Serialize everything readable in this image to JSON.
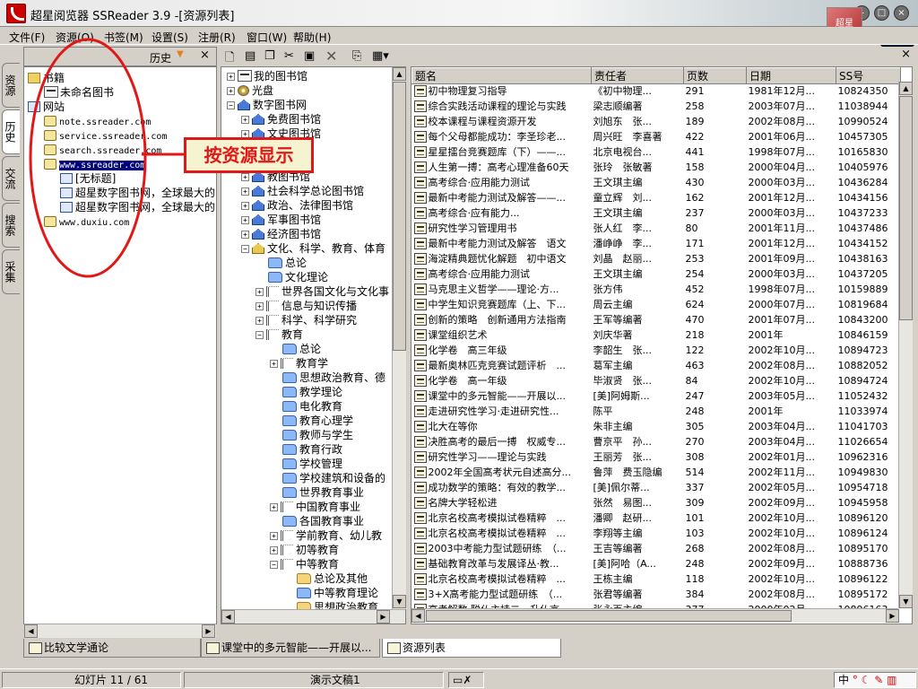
{
  "title": "超星阅览器 SSReader 3.9 -[资源列表]",
  "logos": {
    "brand_label": "超星"
  },
  "menu": [
    "文件(F)",
    "资源(O)",
    "书签(M)",
    "设置(S)",
    "注册(R)",
    "窗口(W)",
    "帮助(H)"
  ],
  "side_tabs": [
    "资源",
    "历史",
    "交流",
    "搜索",
    "采集"
  ],
  "history_panel": {
    "label": "历史",
    "tree": [
      {
        "label": "书籍",
        "type": "folder",
        "level": 0
      },
      {
        "label": "未命名图书",
        "type": "book",
        "level": 1
      },
      {
        "label": "网站",
        "type": "page",
        "level": 0
      },
      {
        "label": "note.ssreader.com",
        "type": "site",
        "level": 1
      },
      {
        "label": "service.ssreader.com",
        "type": "site",
        "level": 1
      },
      {
        "label": "search.ssreader.com",
        "type": "site",
        "level": 1
      },
      {
        "label": "www.ssreader.com",
        "type": "site",
        "level": 1,
        "selected": true
      },
      {
        "label": "[无标题]",
        "type": "page",
        "level": 2
      },
      {
        "label": "超星数字图书网，全球最大的",
        "type": "page",
        "level": 2
      },
      {
        "label": "超星数字图书网，全球最大的",
        "type": "page",
        "level": 2
      },
      {
        "label": "www.duxiu.com",
        "type": "site",
        "level": 1
      }
    ]
  },
  "annotation": {
    "text": "按资源显示"
  },
  "resource_tree": [
    {
      "label": "我的图书馆",
      "toggle": "+",
      "icon": "book",
      "level": 0
    },
    {
      "label": "光盘",
      "toggle": "+",
      "icon": "disc",
      "level": 0
    },
    {
      "label": "数字图书网",
      "toggle": "-",
      "icon": "lib",
      "level": 0
    },
    {
      "label": "免费图书馆",
      "toggle": "+",
      "icon": "lib",
      "level": 1
    },
    {
      "label": "文史图书馆",
      "toggle": "+",
      "icon": "lib",
      "level": 1
    },
    {
      "label": "",
      "toggle": "+",
      "icon": "lib",
      "level": 1
    },
    {
      "label": "图书馆",
      "toggle": "+",
      "icon": "lib",
      "level": 1
    },
    {
      "label": "教图书馆",
      "toggle": "+",
      "icon": "lib",
      "level": 1
    },
    {
      "label": "社会科学总论图书馆",
      "toggle": "+",
      "icon": "lib",
      "level": 1
    },
    {
      "label": "政治、法律图书馆",
      "toggle": "+",
      "icon": "lib",
      "level": 1
    },
    {
      "label": "军事图书馆",
      "toggle": "+",
      "icon": "lib",
      "level": 1
    },
    {
      "label": "经济图书馆",
      "toggle": "+",
      "icon": "lib",
      "level": 1
    },
    {
      "label": "文化、科学、教育、体育",
      "toggle": "-",
      "icon": "lib-y",
      "level": 1
    },
    {
      "label": "总论",
      "toggle": "",
      "icon": "cat",
      "level": 2
    },
    {
      "label": "文化理论",
      "toggle": "",
      "icon": "cat",
      "level": 2
    },
    {
      "label": "世界各国文化与文化事",
      "toggle": "+",
      "icon": "grp",
      "level": 2
    },
    {
      "label": "信息与知识传播",
      "toggle": "+",
      "icon": "grp",
      "level": 2
    },
    {
      "label": "科学、科学研究",
      "toggle": "+",
      "icon": "grp",
      "level": 2
    },
    {
      "label": "教育",
      "toggle": "-",
      "icon": "grp",
      "level": 2
    },
    {
      "label": "总论",
      "toggle": "",
      "icon": "cat",
      "level": 3
    },
    {
      "label": "教育学",
      "toggle": "+",
      "icon": "grp",
      "level": 3
    },
    {
      "label": "思想政治教育、德",
      "toggle": "",
      "icon": "cat",
      "level": 3
    },
    {
      "label": "教学理论",
      "toggle": "",
      "icon": "cat",
      "level": 3
    },
    {
      "label": "电化教育",
      "toggle": "",
      "icon": "cat",
      "level": 3
    },
    {
      "label": "教育心理学",
      "toggle": "",
      "icon": "cat",
      "level": 3
    },
    {
      "label": "教师与学生",
      "toggle": "",
      "icon": "cat",
      "level": 3
    },
    {
      "label": "教育行政",
      "toggle": "",
      "icon": "cat",
      "level": 3
    },
    {
      "label": "学校管理",
      "toggle": "",
      "icon": "cat",
      "level": 3
    },
    {
      "label": "学校建筑和设备的",
      "toggle": "",
      "icon": "cat",
      "level": 3
    },
    {
      "label": "世界教育事业",
      "toggle": "",
      "icon": "cat",
      "level": 3
    },
    {
      "label": "中国教育事业",
      "toggle": "+",
      "icon": "grp",
      "level": 3
    },
    {
      "label": "各国教育事业",
      "toggle": "",
      "icon": "cat",
      "level": 3
    },
    {
      "label": "学前教育、幼儿教",
      "toggle": "+",
      "icon": "grp",
      "level": 3
    },
    {
      "label": "初等教育",
      "toggle": "+",
      "icon": "grp",
      "level": 3
    },
    {
      "label": "中等教育",
      "toggle": "-",
      "icon": "grp",
      "level": 3
    },
    {
      "label": "总论及其他",
      "toggle": "",
      "icon": "cat-y",
      "level": 4
    },
    {
      "label": "中等教育理论",
      "toggle": "",
      "icon": "cat",
      "level": 4
    },
    {
      "label": "思想政治教育",
      "toggle": "",
      "icon": "cat-y",
      "level": 4
    }
  ],
  "resource_list": {
    "columns": [
      "题名",
      "责任者",
      "页数",
      "日期",
      "SS号"
    ],
    "rows": [
      [
        "初中物理复习指导",
        "《初中物理...",
        "291",
        "1981年12月...",
        "10824350"
      ],
      [
        "综合实践活动课程的理论与实践",
        "梁志顺编著",
        "258",
        "2003年07月...",
        "11038944"
      ],
      [
        "校本课程与课程资源开发",
        "刘旭东　张...",
        "189",
        "2002年08月...",
        "10990524"
      ],
      [
        "每个父母都能成功：李圣珍老...",
        "周兴旺　李喜著",
        "422",
        "2001年06月...",
        "10457305"
      ],
      [
        "星星擂台竞赛题库（下）——...",
        "北京电视台...",
        "441",
        "1998年07月...",
        "10165830"
      ],
      [
        "人生第一搏：高考心理准备60天",
        "张玲　张敏著",
        "158",
        "2000年04月...",
        "10405976"
      ],
      [
        "高考综合·应用能力测试",
        "王文琪主编",
        "430",
        "2000年03月...",
        "10436284"
      ],
      [
        "最新中考能力测试及解答——...",
        "童立辉　刘...",
        "162",
        "2001年12月...",
        "10434156"
      ],
      [
        "高考综合·应有能力...",
        "王文琪主编",
        "237",
        "2000年03月...",
        "10437233"
      ],
      [
        "研究性学习管理用书",
        "张人红　李...",
        "80",
        "2001年11月...",
        "10437486"
      ],
      [
        "最新中考能力测试及解答　语文",
        "潘峥峥　李...",
        "171",
        "2001年12月...",
        "10434152"
      ],
      [
        "海淀精典题忧化解题　初中语文",
        "刘晶　赵丽...",
        "253",
        "2001年09月...",
        "10438163"
      ],
      [
        "高考综合·应用能力测试",
        "王文琪主编",
        "254",
        "2000年03月...",
        "10437205"
      ],
      [
        "马克思主义哲学——理论·方...",
        "张方伟",
        "452",
        "1998年07月...",
        "10159889"
      ],
      [
        "中学生知识竞赛题库（上、下...",
        "周云主编",
        "624",
        "2000年07月...",
        "10819684"
      ],
      [
        "创新的策略　创新通用方法指南",
        "王军等编著",
        "470",
        "2001年07月...",
        "10843200"
      ],
      [
        "课堂组织艺术",
        "刘庆华著",
        "218",
        "2001年",
        "10846159"
      ],
      [
        "化学卷　高三年级",
        "李韶生　张...",
        "122",
        "2002年10月...",
        "10894723"
      ],
      [
        "最新奥林匹克竞赛试题评析　...",
        "葛军主编",
        "463",
        "2002年08月...",
        "10882052"
      ],
      [
        "化学卷　高一年级",
        "毕淑贤　张...",
        "84",
        "2002年10月...",
        "10894724"
      ],
      [
        "课堂中的多元智能——开展以...",
        "[美]阿姆斯...",
        "247",
        "2003年05月...",
        "11052432"
      ],
      [
        "走进研究性学习·走进研究性...",
        "陈平",
        "248",
        "2001年",
        "11033974"
      ],
      [
        "北大在等你",
        "朱非主编",
        "305",
        "2003年04月...",
        "11041703"
      ],
      [
        "决胜高考的最后一搏　权威专...",
        "曹京平　孙...",
        "270",
        "2003年04月...",
        "11026654"
      ],
      [
        "研究性学习——理论与实践",
        "王丽芳　张...",
        "308",
        "2002年01月...",
        "10962316"
      ],
      [
        "2002年全国高考状元自述高分...",
        "鲁萍　费玉隐编",
        "514",
        "2002年11月...",
        "10949830"
      ],
      [
        "成功数学的策略：有效的教学...",
        "[美]佩尔蒂...",
        "337",
        "2002年05月...",
        "10954718"
      ],
      [
        "名牌大学轻松进",
        "张然　易图...",
        "309",
        "2002年09月...",
        "10945958"
      ],
      [
        "北京名校高考模拟试卷精粹　...",
        "潘卿　赵研...",
        "101",
        "2002年10月...",
        "10896120"
      ],
      [
        "北京名校高考模拟试卷精粹　...",
        "李翔等主编",
        "103",
        "2002年10月...",
        "10896124"
      ],
      [
        "2003中考能力型试题研练　（...",
        "王吉等编著",
        "268",
        "2002年08月...",
        "10895170"
      ],
      [
        "基础教育改革与发展译丛·教...",
        "[美]阿哈（A...",
        "248",
        "2002年09月...",
        "10888736"
      ],
      [
        "北京名校高考模拟试卷精粹　...",
        "王栋主编",
        "118",
        "2002年10月...",
        "10896122"
      ],
      [
        "3+X高考能力型试题研练　（...",
        "张君等编著",
        "384",
        "2002年08月...",
        "10895172"
      ],
      [
        "高考解数·聪仏主持二　升仏言...",
        "张永百主编",
        "377",
        "2000年02月...",
        "10896163"
      ]
    ]
  },
  "bottom_tabs": [
    "比较文学通论",
    "课堂中的多元智能——开展以...",
    "资源列表"
  ],
  "status": {
    "slide": "幻灯片 11 / 61",
    "doc": "演示文稿1",
    "ime": "中"
  }
}
